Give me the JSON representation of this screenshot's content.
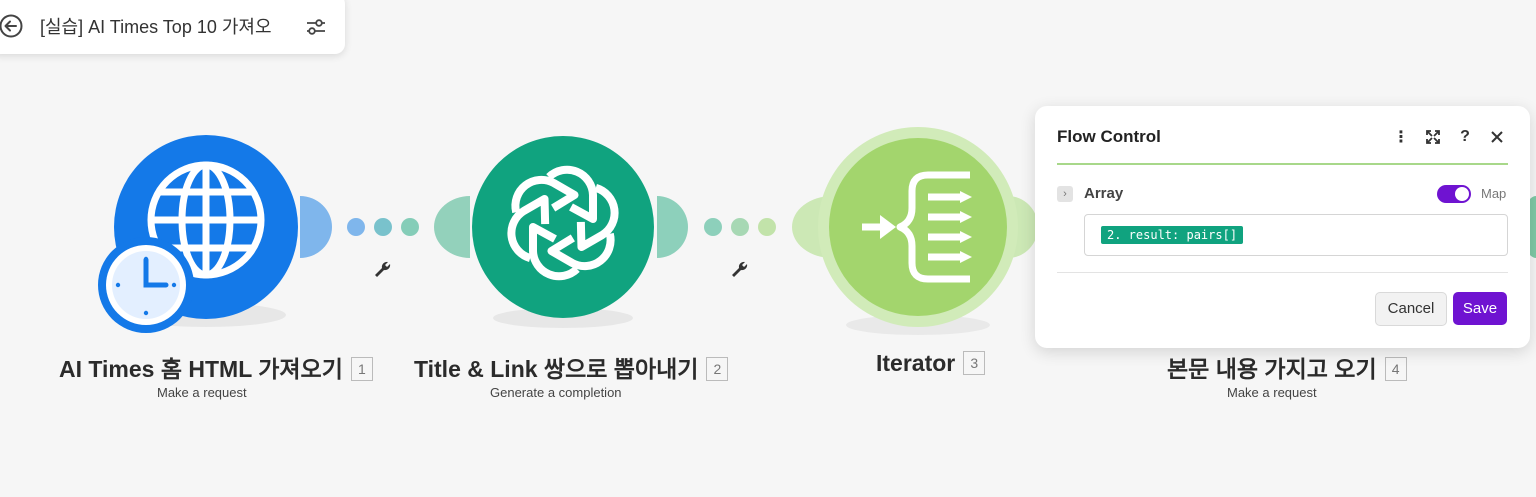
{
  "header": {
    "scenario_title": "[실습] AI Times Top 10 가져오",
    "back_icon": "back-arrow-icon",
    "settings_icon": "sliders-icon"
  },
  "modules": [
    {
      "title": "AI Times 홈 HTML 가져오기",
      "number": "1",
      "subtitle": "Make a request",
      "icon": "globe-clock-icon",
      "color": "#1479e8"
    },
    {
      "title": "Title & Link 쌍으로 뽑아내기",
      "number": "2",
      "subtitle": "Generate a completion",
      "icon": "openai-icon",
      "color": "#10a37f"
    },
    {
      "title": "Iterator",
      "number": "3",
      "subtitle": "",
      "icon": "iterator-icon",
      "color": "#a3d56d"
    },
    {
      "title": "본문 내용 가지고 오기",
      "number": "4",
      "subtitle": "Make a request",
      "icon": "globe-icon",
      "color": "#1479e8"
    }
  ],
  "panel": {
    "title": "Flow Control",
    "field_label": "Array",
    "map_label": "Map",
    "map_enabled": true,
    "field_value": "2. result: pairs[]",
    "cancel_label": "Cancel",
    "save_label": "Save",
    "accent": "#6f13d1"
  }
}
